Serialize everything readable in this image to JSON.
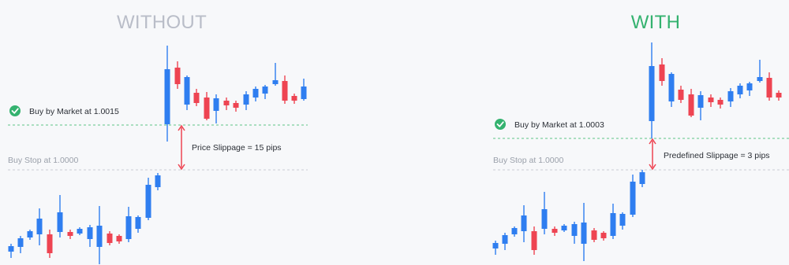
{
  "colors": {
    "bull": "#2f7ef0",
    "bear": "#ee4452",
    "without_heading": "#b9bdc8",
    "with_heading": "#34b26f",
    "market_line": "#5cc486",
    "stop_line": "#c9cdd4",
    "arrow": "#ee4452",
    "check": "#34b26f",
    "text": "#2b2f36",
    "muted": "#9aa0aa"
  },
  "panels": [
    {
      "id": "without",
      "heading": "WITHOUT",
      "market_label": "Buy by Market at 1.0015",
      "stop_label": "Buy Stop at 1.0000",
      "slippage_label": "Price Slippage = 15 pips",
      "check_icon": "check-circle-icon",
      "arrow_icon": "double-arrow-icon"
    },
    {
      "id": "with",
      "heading": "WITH",
      "market_label": "Buy by Market at 1.0003",
      "stop_label": "Buy Stop at 1.0000",
      "slippage_label": "Predefined Slippage = 3 pips",
      "check_icon": "check-circle-icon",
      "arrow_icon": "double-arrow-icon"
    }
  ]
}
